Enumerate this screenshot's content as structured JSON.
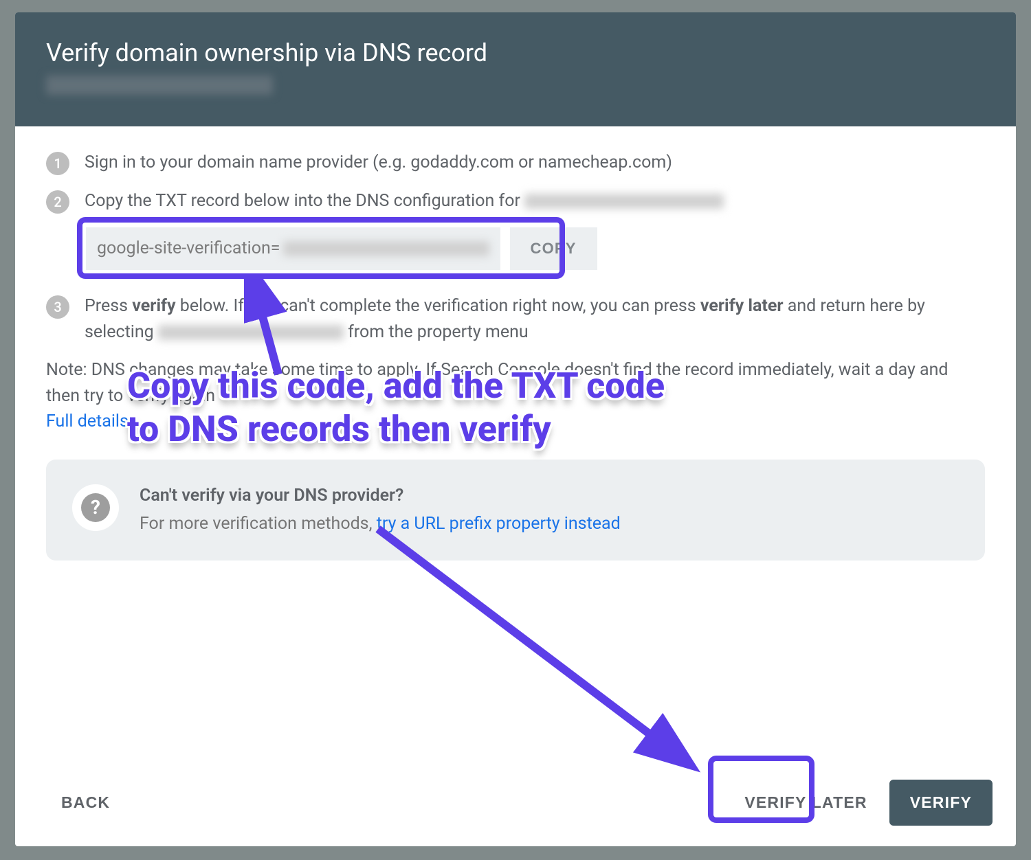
{
  "header": {
    "title": "Verify domain ownership via DNS record"
  },
  "steps": {
    "s1_num": "1",
    "s1_text": "Sign in to your domain name provider (e.g. godaddy.com or namecheap.com)",
    "s2_num": "2",
    "s2_text": "Copy the TXT record below into the DNS configuration for ",
    "txt_value_prefix": "google-site-verification=",
    "copy_label": "COPY",
    "s3_num": "3",
    "s3_pre": "Press ",
    "s3_b1": "verify",
    "s3_mid": " below. If you can't complete the verification right now, you can press ",
    "s3_b2": "verify later",
    "s3_post": " and return here by selecting ",
    "s3_end": " from the property menu"
  },
  "note": {
    "text": "Note: DNS changes may take some time to apply. If Search Console doesn't find the record immediately, wait a day and then try to verify again",
    "full_details": "Full details"
  },
  "info": {
    "title_pre": "Can't verify via ",
    "title_mid": "your DNS",
    "title_post": " provider?",
    "sub_pre": "For more verification methods, ",
    "sub_link": "try a URL prefix property instead"
  },
  "footer": {
    "back": "BACK",
    "verify_later": "VERIFY LATER",
    "verify": "VERIFY"
  },
  "annotation": {
    "text": "Copy this code, add the TXT code to DNS records then verify"
  }
}
